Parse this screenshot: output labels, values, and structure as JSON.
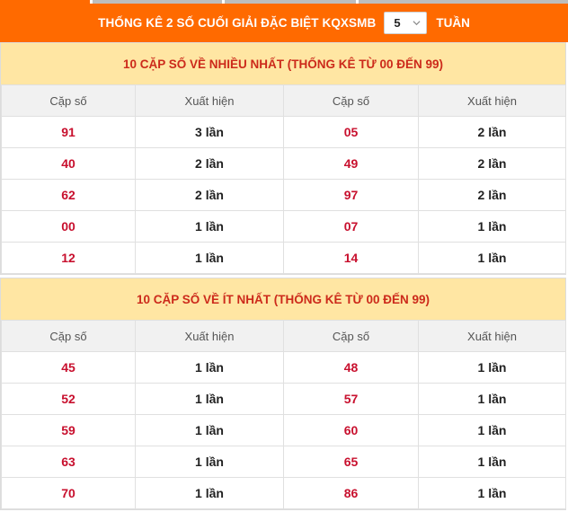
{
  "colors": {
    "header_bg": "#ff6a00",
    "section_title_bg": "#ffe6a3",
    "section_title_text": "#cc2a1b",
    "number_text": "#c8102e",
    "strip_active": "#ff6a00",
    "strip_inactive": "#bdbdbd"
  },
  "header": {
    "title": "THỐNG KÊ 2 SỐ CUỐI GIẢI ĐẶC BIỆT KQXSMB",
    "weeks_value": "5",
    "suffix": "TUẦN"
  },
  "most": {
    "title": "10 CẶP SỐ VỀ NHIỀU NHẤT (THỐNG KÊ TỪ 00 ĐẾN 99)",
    "col_pair": "Cặp số",
    "col_count": "Xuất hiện",
    "rows": [
      {
        "n1": "91",
        "c1": "3 lần",
        "n2": "05",
        "c2": "2 lần"
      },
      {
        "n1": "40",
        "c1": "2 lần",
        "n2": "49",
        "c2": "2 lần"
      },
      {
        "n1": "62",
        "c1": "2 lần",
        "n2": "97",
        "c2": "2 lần"
      },
      {
        "n1": "00",
        "c1": "1 lần",
        "n2": "07",
        "c2": "1 lần"
      },
      {
        "n1": "12",
        "c1": "1 lần",
        "n2": "14",
        "c2": "1 lần"
      }
    ]
  },
  "least": {
    "title": "10 CẶP SỐ VỀ ÍT NHẤT (THỐNG KÊ TỪ 00 ĐẾN 99)",
    "col_pair": "Cặp số",
    "col_count": "Xuất hiện",
    "rows": [
      {
        "n1": "45",
        "c1": "1 lần",
        "n2": "48",
        "c2": "1 lần"
      },
      {
        "n1": "52",
        "c1": "1 lần",
        "n2": "57",
        "c2": "1 lần"
      },
      {
        "n1": "59",
        "c1": "1 lần",
        "n2": "60",
        "c2": "1 lần"
      },
      {
        "n1": "63",
        "c1": "1 lần",
        "n2": "65",
        "c2": "1 lần"
      },
      {
        "n1": "70",
        "c1": "1 lần",
        "n2": "86",
        "c2": "1 lần"
      }
    ]
  }
}
